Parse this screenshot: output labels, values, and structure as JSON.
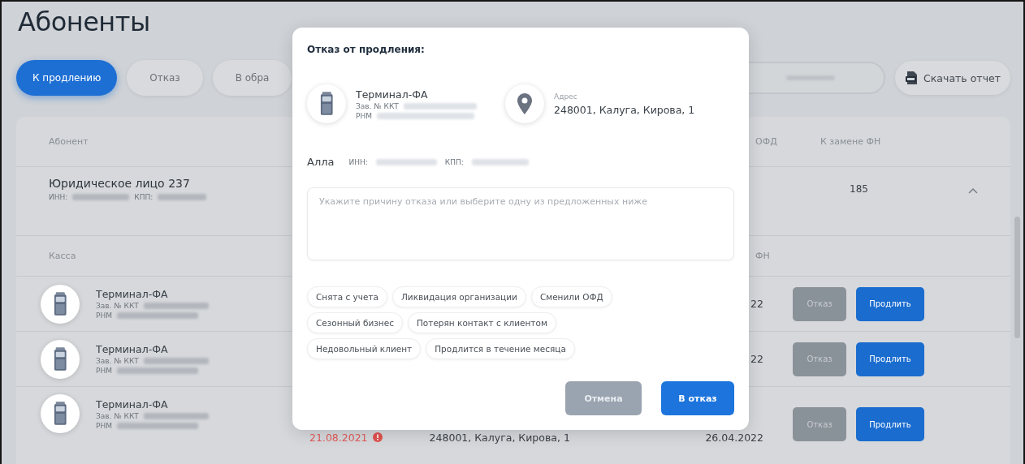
{
  "page": {
    "title": "Абоненты"
  },
  "tabs": [
    {
      "label": "К продлению",
      "selected": true
    },
    {
      "label": "Отказ",
      "selected": false
    },
    {
      "label": "В обра",
      "selected": false
    }
  ],
  "download_button": {
    "label": "Скачать отчет"
  },
  "table": {
    "columns": [
      {
        "label": "Абонент"
      },
      {
        "label": "ОФД"
      },
      {
        "label": "К замене ФН"
      }
    ],
    "group": {
      "name": "Юридическое лицо 237",
      "inn_label": "ИНН:",
      "kpp_label": "КПП:",
      "count": "185",
      "expanded": true
    },
    "subcolumns": [
      {
        "label": "Касса"
      },
      {
        "label": "ФН"
      }
    ],
    "rows": [
      {
        "device": "Терминал-ФА",
        "serial_label": "Зав. № ККТ",
        "rnm_label": "РНМ",
        "date": "22",
        "refuse": "Отказ",
        "renew": "Продлить"
      },
      {
        "device": "Терминал-ФА",
        "serial_label": "Зав. № ККТ",
        "rnm_label": "РНМ",
        "date": "22",
        "refuse": "Отказ",
        "renew": "Продлить"
      },
      {
        "device": "Терминал-ФА",
        "serial_label": "Зав. № ККТ",
        "rnm_label": "РНМ",
        "expiry": "21.08.2021",
        "overdue": true,
        "address": "248001, Калуга, Кирова, 1",
        "date": "26.04.2022",
        "refuse": "Отказ",
        "renew": "Продлить"
      }
    ]
  },
  "dialog": {
    "title": "Отказ от продления:",
    "device": "Терминал-ФА",
    "serial_label": "Зав. № ККТ",
    "rnm_label": "РНМ",
    "address_label": "Адрес",
    "address": "248001, Калуга, Кирова, 1",
    "client": "Алла",
    "inn_label": "ИНН:",
    "kpp_label": "КПП:",
    "reason": {
      "placeholder": "Укажите причину отказа или выберите одну из предложенных ниже"
    },
    "reasons": [
      {
        "label": "Снята с учета",
        "selected": false
      },
      {
        "label": "Ликвидация организации",
        "selected": false
      },
      {
        "label": "Сменили ОФД",
        "selected": false
      },
      {
        "label": "Сезонный бизнес",
        "selected": false
      },
      {
        "label": "Потерян контакт с клиентом",
        "selected": false
      },
      {
        "label": "Недовольный клиент",
        "selected": false
      },
      {
        "label": "Продлится в течение месяца",
        "selected": false
      }
    ],
    "cancel": "Отмена",
    "submit": "В отказ"
  }
}
